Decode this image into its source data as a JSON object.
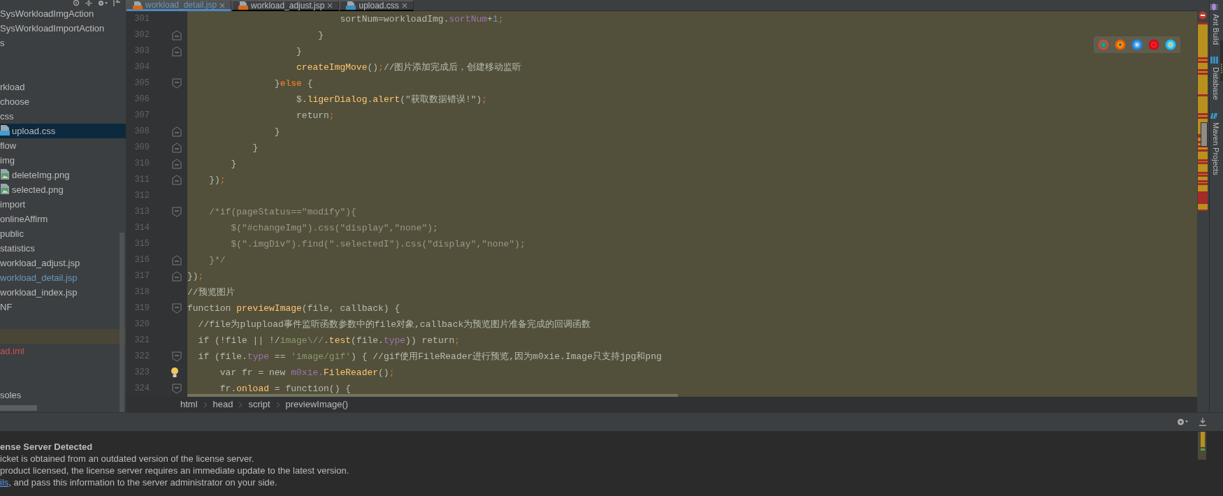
{
  "project_tree": {
    "items": [
      {
        "kind": "node",
        "text": "SysWorkloadImgAction",
        "selected": false,
        "color": "#bbbbbb"
      },
      {
        "kind": "node",
        "text": "SysWorkloadImportAction",
        "selected": false,
        "color": "#bbbbbb"
      },
      {
        "kind": "node",
        "text": "s",
        "selected": false,
        "color": "#bbbbbb"
      },
      {
        "kind": "spacer"
      },
      {
        "kind": "spacer"
      },
      {
        "kind": "node",
        "text": "rkload",
        "selected": false,
        "color": "#bbbbbb"
      },
      {
        "kind": "node",
        "text": "choose",
        "selected": false,
        "color": "#bbbbbb"
      },
      {
        "kind": "node",
        "text": "css",
        "selected": false,
        "color": "#bbbbbb"
      },
      {
        "kind": "css-file",
        "text": "upload.css",
        "selected": true,
        "color": "#bbbbbb"
      },
      {
        "kind": "node",
        "text": "flow",
        "selected": false,
        "color": "#bbbbbb"
      },
      {
        "kind": "node",
        "text": "img",
        "selected": false,
        "color": "#bbbbbb"
      },
      {
        "kind": "image-file",
        "text": "deleteImg.png",
        "selected": false,
        "color": "#bbbbbb"
      },
      {
        "kind": "image-file",
        "text": "selected.png",
        "selected": false,
        "color": "#bbbbbb"
      },
      {
        "kind": "node",
        "text": "import",
        "selected": false,
        "color": "#bbbbbb"
      },
      {
        "kind": "node",
        "text": "onlineAffirm",
        "selected": false,
        "color": "#bbbbbb"
      },
      {
        "kind": "node",
        "text": "public",
        "selected": false,
        "color": "#bbbbbb"
      },
      {
        "kind": "node",
        "text": "statistics",
        "selected": false,
        "color": "#bbbbbb"
      },
      {
        "kind": "node",
        "text": "workload_adjust.jsp",
        "selected": false,
        "color": "#bbbbbb"
      },
      {
        "kind": "node",
        "text": "workload_detail.jsp",
        "selected": false,
        "color": "#6897bb"
      },
      {
        "kind": "node",
        "text": "workload_index.jsp",
        "selected": false,
        "color": "#bbbbbb"
      },
      {
        "kind": "node",
        "text": "NF",
        "selected": false,
        "color": "#bbbbbb"
      },
      {
        "kind": "spacer"
      },
      {
        "kind": "spacer",
        "selected": true
      },
      {
        "kind": "node",
        "text": "ad.iml",
        "selected": false,
        "color": "#c75450"
      },
      {
        "kind": "spacer"
      },
      {
        "kind": "spacer"
      },
      {
        "kind": "node",
        "text": "soles",
        "selected": false,
        "color": "#bbbbbb"
      }
    ]
  },
  "editor": {
    "tabs": [
      {
        "label": "workload_detail.jsp",
        "kind": "jsp",
        "selected": true
      },
      {
        "label": "workload_adjust.jsp",
        "kind": "jsp",
        "selected": false
      },
      {
        "label": "upload.css",
        "kind": "css",
        "selected": false
      }
    ],
    "lines": [
      {
        "number": "301",
        "tokens": [
          {
            "text": "                            sortNum=workloadImg.",
            "kind": "plain"
          },
          {
            "text": "sortNum",
            "kind": "property"
          },
          {
            "text": "+",
            "kind": "plain"
          },
          {
            "text": "1",
            "kind": "number"
          },
          {
            "text": ";",
            "kind": "punct"
          }
        ]
      },
      {
        "number": "302",
        "fold": {
          "kind": "end"
        },
        "tokens": [
          {
            "text": "                        }",
            "kind": "plain"
          }
        ]
      },
      {
        "number": "303",
        "fold": {
          "kind": "end"
        },
        "tokens": [
          {
            "text": "                    }",
            "kind": "plain"
          }
        ]
      },
      {
        "number": "304",
        "tokens": [
          {
            "text": "                    createImgMove",
            "kind": "function"
          },
          {
            "text": "()",
            "kind": "plain"
          },
          {
            "text": ";",
            "kind": "punct"
          },
          {
            "text": "//图片添加完成后，创建移动监听",
            "kind": "plain"
          }
        ]
      },
      {
        "number": "305",
        "fold": {
          "kind": "start"
        },
        "tokens": [
          {
            "text": "                }",
            "kind": "plain"
          },
          {
            "text": "else",
            "kind": "keyword"
          },
          {
            "text": " {",
            "kind": "plain"
          }
        ]
      },
      {
        "number": "306",
        "tokens": [
          {
            "text": "                    $.",
            "kind": "plain"
          },
          {
            "text": "ligerDialog",
            "kind": "function"
          },
          {
            "text": ".",
            "kind": "plain"
          },
          {
            "text": "alert",
            "kind": "function"
          },
          {
            "text": "(\"获取数据错误!\")",
            "kind": "plain"
          },
          {
            "text": ";",
            "kind": "punct"
          }
        ]
      },
      {
        "number": "307",
        "tokens": [
          {
            "text": "                    return",
            "kind": "plain"
          },
          {
            "text": ";",
            "kind": "punct"
          }
        ]
      },
      {
        "number": "308",
        "fold": {
          "kind": "end"
        },
        "tokens": [
          {
            "text": "                }",
            "kind": "plain"
          }
        ]
      },
      {
        "number": "309",
        "fold": {
          "kind": "end"
        },
        "tokens": [
          {
            "text": "            }",
            "kind": "plain"
          }
        ]
      },
      {
        "number": "310",
        "fold": {
          "kind": "end"
        },
        "tokens": [
          {
            "text": "        }",
            "kind": "plain"
          }
        ]
      },
      {
        "number": "311",
        "fold": {
          "kind": "end"
        },
        "tokens": [
          {
            "text": "    })",
            "kind": "plain"
          },
          {
            "text": ";",
            "kind": "punct"
          }
        ]
      },
      {
        "number": "312"
      },
      {
        "number": "313",
        "fold": {
          "kind": "start"
        },
        "tokens": [
          {
            "text": "    /*if(pageStatus==\"modify\"){",
            "kind": "comment"
          }
        ]
      },
      {
        "number": "314",
        "tokens": [
          {
            "text": "        $(\"#changeImg\").css(\"display\",\"none\");",
            "kind": "comment"
          }
        ]
      },
      {
        "number": "315",
        "tokens": [
          {
            "text": "        $(\".imgDiv\").find(\".selectedI\").css(\"display\",\"none\");",
            "kind": "comment"
          }
        ]
      },
      {
        "number": "316",
        "fold": {
          "kind": "end"
        },
        "tokens": [
          {
            "text": "    }*/",
            "kind": "comment"
          }
        ]
      },
      {
        "number": "317",
        "fold": {
          "kind": "end"
        },
        "tokens": [
          {
            "text": "})",
            "kind": "plain"
          },
          {
            "text": ";",
            "kind": "punct"
          }
        ]
      },
      {
        "number": "318",
        "tokens": [
          {
            "text": "//预览图片",
            "kind": "plain"
          }
        ]
      },
      {
        "number": "319",
        "fold": {
          "kind": "start"
        },
        "tokens": [
          {
            "text": "function ",
            "kind": "plain"
          },
          {
            "text": "previewImage",
            "kind": "function"
          },
          {
            "text": "(file, callback) {",
            "kind": "plain"
          }
        ]
      },
      {
        "number": "320",
        "tokens": [
          {
            "text": "  //file为plupload事件监听函数参数中的file对象,callback为预览图片准备完成的回调函数",
            "kind": "plain"
          }
        ]
      },
      {
        "number": "321",
        "tokens": [
          {
            "text": "  if (!file || !/",
            "kind": "plain"
          },
          {
            "text": "image\\//",
            "kind": "string"
          },
          {
            "text": ".",
            "kind": "plain"
          },
          {
            "text": "test",
            "kind": "function"
          },
          {
            "text": "(file.",
            "kind": "plain"
          },
          {
            "text": "type",
            "kind": "property"
          },
          {
            "text": ")) return",
            "kind": "plain"
          },
          {
            "text": ";",
            "kind": "punct"
          }
        ]
      },
      {
        "number": "322",
        "fold": {
          "kind": "start"
        },
        "tokens": [
          {
            "text": "  if (file.",
            "kind": "plain"
          },
          {
            "text": "type",
            "kind": "property"
          },
          {
            "text": " == ",
            "kind": "plain"
          },
          {
            "text": "'image/gif'",
            "kind": "string"
          },
          {
            "text": ") { //gif使用FileReader进行预览,因为m0xie.Image只支持jpg和png",
            "kind": "plain"
          }
        ]
      },
      {
        "number": "323",
        "bulb": true,
        "tokens": [
          {
            "text": "      var fr = new ",
            "kind": "plain"
          },
          {
            "text": "m0xie.",
            "kind": "property"
          },
          {
            "text": "FileReader",
            "kind": "function"
          },
          {
            "text": "()",
            "kind": "plain"
          },
          {
            "text": ";",
            "kind": "punct"
          }
        ]
      },
      {
        "number": "324",
        "fold": {
          "kind": "start"
        },
        "tokens": [
          {
            "text": "      fr.",
            "kind": "plain"
          },
          {
            "text": "onload",
            "kind": "function"
          },
          {
            "text": " = function() {",
            "kind": "plain"
          }
        ]
      }
    ],
    "breadcrumb": [
      "html",
      "head",
      "script",
      "previewImage()"
    ]
  },
  "tool_windows": [
    "Ant Build",
    "Database",
    "Maven Projects"
  ],
  "notification": {
    "title": "ense Server Detected",
    "lines": [
      {
        "text": "icket is obtained from an outdated version of the license server."
      },
      {
        "text": "product licensed, the license server requires an immediate update to the latest version."
      },
      {
        "link": "ils",
        "text": ", and pass this information to the server administrator on your side."
      }
    ]
  }
}
